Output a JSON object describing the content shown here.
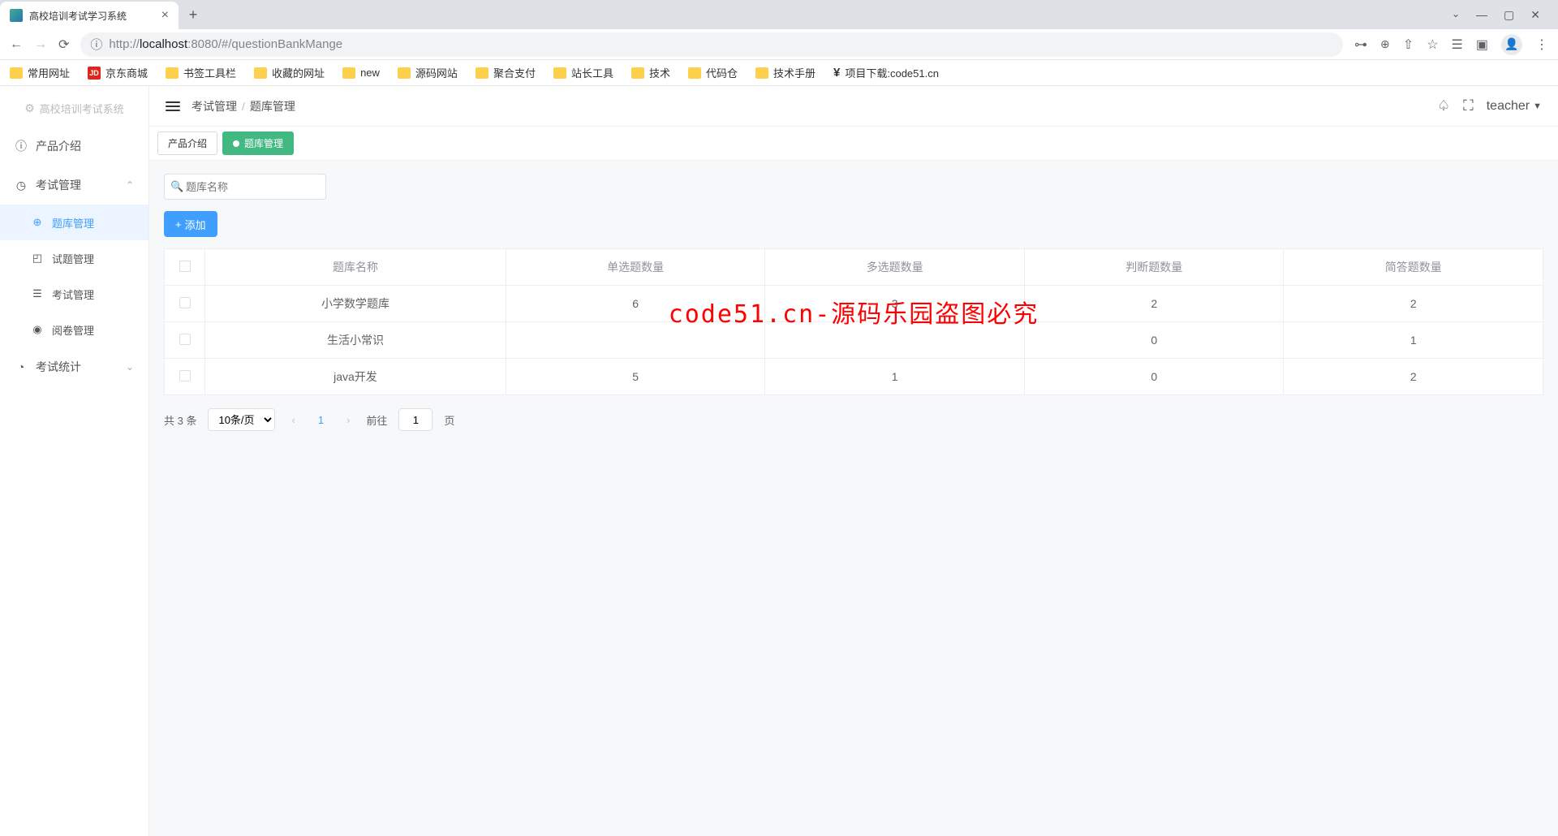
{
  "browser": {
    "tab_title": "高校培训考试学习系统",
    "url_prefix": "http://",
    "url_host": "localhost",
    "url_port": ":8080",
    "url_path": "/#/questionBankMange",
    "bookmarks": [
      "常用网址",
      "京东商城",
      "书签工具栏",
      "收藏的网址",
      "new",
      "源码网站",
      "聚合支付",
      "站长工具",
      "技术",
      "代码仓",
      "技术手册",
      "项目下载:code51.cn"
    ]
  },
  "app": {
    "brand": "高校培训考试系统",
    "user": "teacher",
    "breadcrumb": {
      "a": "考试管理",
      "b": "题库管理"
    },
    "menu": {
      "product": "产品介绍",
      "exam_mgmt": "考试管理",
      "question_bank": "题库管理",
      "question_mgmt": "试题管理",
      "exam": "考试管理",
      "review": "阅卷管理",
      "stats": "考试统计"
    },
    "tabs": {
      "t1": "产品介绍",
      "t2": "题库管理"
    },
    "search_placeholder": "题库名称",
    "add_label": "添加",
    "table": {
      "headers": {
        "name": "题库名称",
        "single": "单选题数量",
        "multi": "多选题数量",
        "judge": "判断题数量",
        "short": "简答题数量"
      },
      "rows": [
        {
          "name": "小学数学题库",
          "single": "6",
          "multi": "3",
          "judge": "2",
          "short": "2"
        },
        {
          "name": "生活小常识",
          "single": "",
          "multi": "",
          "judge": "0",
          "short": "1"
        },
        {
          "name": "java开发",
          "single": "5",
          "multi": "1",
          "judge": "0",
          "short": "2"
        }
      ]
    },
    "pagination": {
      "total": "共 3 条",
      "per_page": "10条/页",
      "current": "1",
      "goto_prefix": "前往",
      "goto_value": "1",
      "goto_suffix": "页"
    },
    "watermark": "code51.cn-源码乐园盗图必究"
  }
}
